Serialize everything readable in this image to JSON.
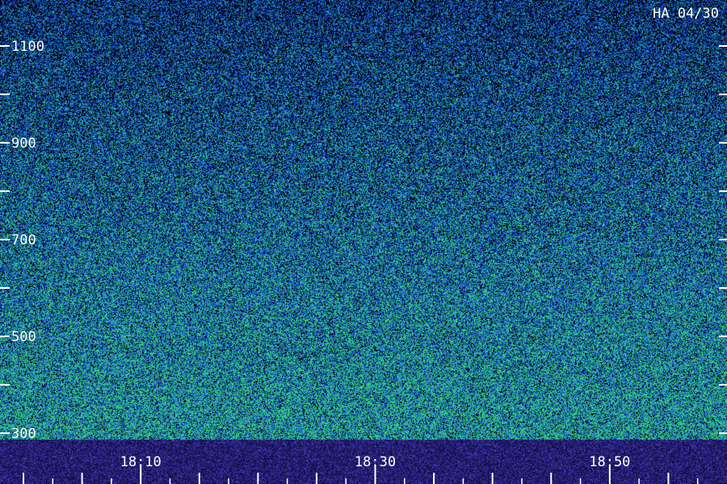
{
  "chart_data": {
    "type": "heatmap",
    "title": "HA 04/30",
    "xlabel": "",
    "ylabel": "",
    "x_ticks": [
      {
        "value": "18:00",
        "label": ""
      },
      {
        "value": "18:05",
        "label": ""
      },
      {
        "value": "18:10",
        "label": "18:10"
      },
      {
        "value": "18:15",
        "label": ""
      },
      {
        "value": "18:20",
        "label": ""
      },
      {
        "value": "18:25",
        "label": ""
      },
      {
        "value": "18:30",
        "label": "18:30"
      },
      {
        "value": "18:35",
        "label": ""
      },
      {
        "value": "18:40",
        "label": ""
      },
      {
        "value": "18:45",
        "label": ""
      },
      {
        "value": "18:50",
        "label": "18:50"
      },
      {
        "value": "18:55",
        "label": ""
      }
    ],
    "x_range": [
      "17:58",
      "19:00"
    ],
    "y_ticks": [
      {
        "value": 300,
        "label": "300"
      },
      {
        "value": 400,
        "label": ""
      },
      {
        "value": 500,
        "label": "500"
      },
      {
        "value": 600,
        "label": ""
      },
      {
        "value": 700,
        "label": "700"
      },
      {
        "value": 800,
        "label": ""
      },
      {
        "value": 900,
        "label": "900"
      },
      {
        "value": 1000,
        "label": ""
      },
      {
        "value": 1100,
        "label": "1100"
      }
    ],
    "y_range": [
      300,
      1100
    ],
    "colormap": [
      "#000000",
      "#0a1a8c",
      "#1a3cd8",
      "#1e78c8",
      "#20a0a8",
      "#3ad27a"
    ],
    "grid": false,
    "legend": "none"
  }
}
